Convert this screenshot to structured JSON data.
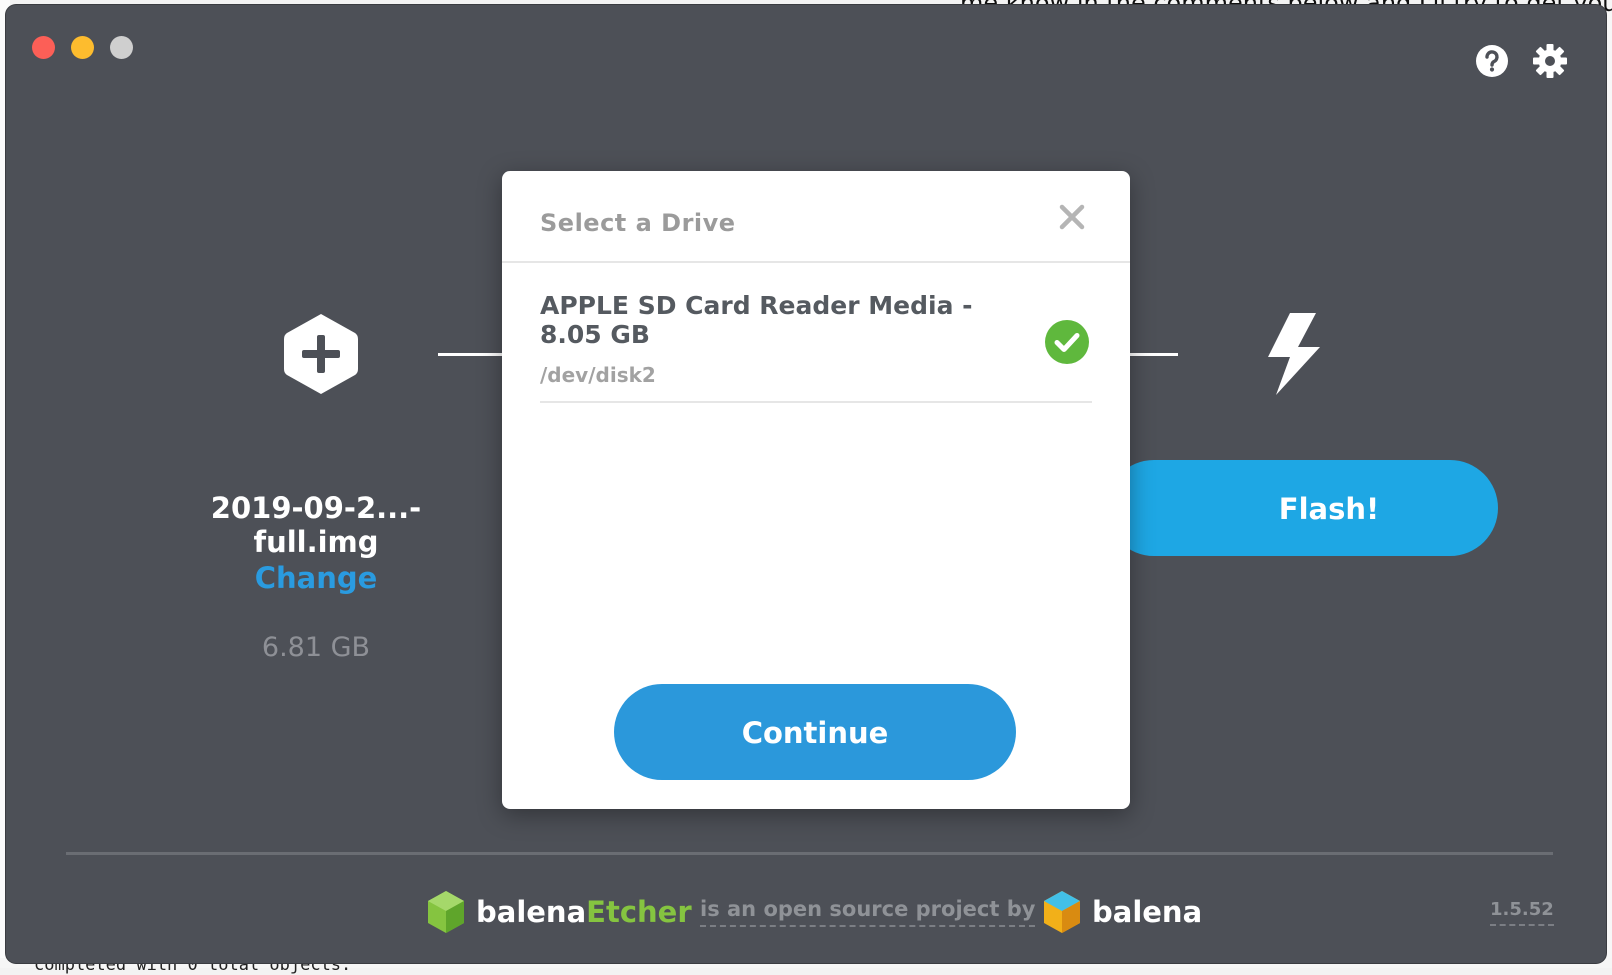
{
  "app": {
    "window_controls": [
      "close",
      "minimize",
      "zoom"
    ],
    "top_icons": [
      "help-icon",
      "gear-icon"
    ]
  },
  "background_page": {
    "top_text": "me know in the comments below and I'll try to get you",
    "bottom_text": "completed with 0 total objects."
  },
  "steps": {
    "image": {
      "icon": "plus-hexagon-icon",
      "filename": "2019-09-2...-full.img",
      "change_label": "Change",
      "size": "6.81 GB"
    },
    "flash": {
      "icon": "lightning-icon",
      "button_label": "Flash!"
    }
  },
  "modal": {
    "title": "Select a Drive",
    "close_icon": "close-icon",
    "drives": [
      {
        "name": "APPLE SD Card Reader Media - 8.05 GB",
        "path": "/dev/disk2",
        "selected": true
      }
    ],
    "continue_label": "Continue"
  },
  "footer": {
    "etcher_brand": "balena",
    "etcher_accent": "Etcher",
    "oss_text": "is an open source project by",
    "balena_brand": "balena",
    "version": "1.5.52"
  },
  "colors": {
    "window_bg": "#4d5057",
    "accent_blue": "#2b98db",
    "flash_blue": "#1ea7e4",
    "check_green": "#5fb83d",
    "etcher_green": "#85c440"
  }
}
